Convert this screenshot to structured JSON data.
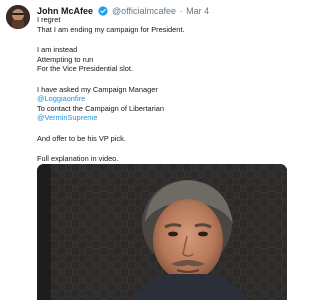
{
  "tweet": {
    "author_name": "John McAfee",
    "handle": "@officialmcafee",
    "separator": "·",
    "date": "Mar 4",
    "lines": [
      "I regret",
      "That I am ending my campaign for President.",
      "",
      "I am instead",
      "Attempting to run",
      "For the Vice Presidential slot.",
      "",
      "I have asked my Campaign Manager",
      "@Loggiaonfire",
      "To contact the Campaign of Libertarian",
      "@VerminSupreme",
      "",
      "And offer to be his VP pick.",
      "",
      "Full explanation in video."
    ],
    "mentions": [
      "@Loggiaonfire",
      "@VerminSupreme"
    ],
    "media_type": "video",
    "colors": {
      "text": "#14171a",
      "secondary": "#657786",
      "link": "#1b95e0",
      "verified": "#1da1f2"
    },
    "icons": [
      "avatar",
      "verified-badge-icon"
    ]
  }
}
